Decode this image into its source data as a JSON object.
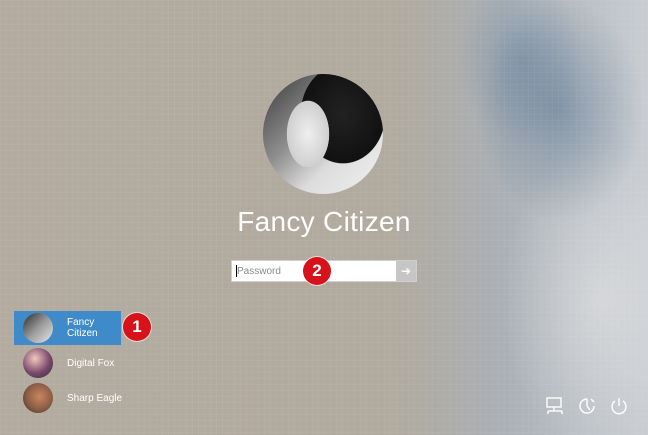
{
  "login": {
    "user_name": "Fancy Citizen",
    "password_placeholder": "Password",
    "submit_icon": "arrow-right-icon"
  },
  "annotations": {
    "badge_1": "1",
    "badge_2": "2"
  },
  "users": [
    {
      "name": "Fancy Citizen",
      "selected": true
    },
    {
      "name": "Digital Fox",
      "selected": false
    },
    {
      "name": "Sharp Eagle",
      "selected": false
    }
  ],
  "system_icons": [
    "network-icon",
    "ease-of-access-icon",
    "power-icon"
  ],
  "colors": {
    "selected_user_bg": "#3f8bc9",
    "badge": "#d7121a"
  }
}
